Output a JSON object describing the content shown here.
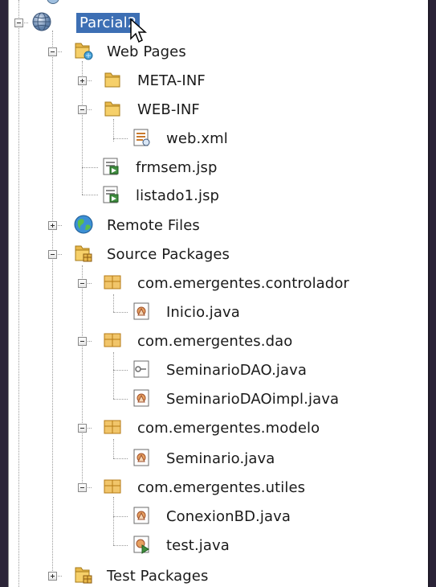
{
  "tree": {
    "project": "Parcial2",
    "web_pages": "Web Pages",
    "meta_inf": "META-INF",
    "web_inf": "WEB-INF",
    "web_xml": "web.xml",
    "frmsem": "frmsem.jsp",
    "listado1": "listado1.jsp",
    "remote_files": "Remote Files",
    "source_packages": "Source Packages",
    "pkg_controlador": "com.emergentes.controlador",
    "inicio": "Inicio.java",
    "pkg_dao": "com.emergentes.dao",
    "seminario_dao": "SeminarioDAO.java",
    "seminario_dao_impl": "SeminarioDAOimpl.java",
    "pkg_modelo": "com.emergentes.modelo",
    "seminario": "Seminario.java",
    "pkg_utiles": "com.emergentes.utiles",
    "conexion": "ConexionBD.java",
    "test": "test.java",
    "test_packages": "Test Packages"
  }
}
